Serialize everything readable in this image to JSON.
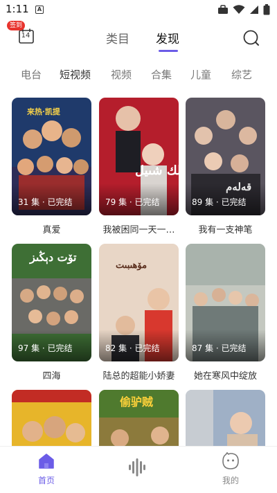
{
  "status_bar": {
    "time": "1:11",
    "a_badge": "A"
  },
  "header": {
    "checkin_badge": "签到",
    "calendar_day": "14",
    "tabs": [
      {
        "label": "类目",
        "active": false
      },
      {
        "label": "发现",
        "active": true
      }
    ]
  },
  "categories": [
    {
      "label": "电台",
      "active": false
    },
    {
      "label": "短视频",
      "active": true
    },
    {
      "label": "视频",
      "active": false
    },
    {
      "label": "合集",
      "active": false
    },
    {
      "label": "儿童",
      "active": false
    },
    {
      "label": "综艺",
      "active": false
    }
  ],
  "dramas": [
    {
      "title": "真爱",
      "episodes": "31 集 · 已完结",
      "color": "#1f3a6b",
      "poster_text": "来热·凯提"
    },
    {
      "title": "我被困同一天一…",
      "episodes": "79 集 · 已完结",
      "color": "#b51e2c",
      "poster_text": "ملك شىيل"
    },
    {
      "title": "我有一支神笔",
      "episodes": "89 集 · 已完结",
      "color": "#5a5560",
      "poster_text": "قەلەم"
    },
    {
      "title": "四海",
      "episodes": "97 集 · 已完结",
      "color": "#3e6f35",
      "poster_text": "تۆت دېڭىز"
    },
    {
      "title": "陆总的超能小娇妻",
      "episodes": "82 集 · 已完结",
      "color": "#e8d6c6",
      "poster_text": "مۆھىبىت"
    },
    {
      "title": "她在寒风中绽放",
      "episodes": "87 集 · 已完结",
      "color": "#c4c8c0",
      "poster_text": ""
    },
    {
      "title": "",
      "episodes": "",
      "color": "#e7b52a",
      "poster_text": ""
    },
    {
      "title": "",
      "episodes": "",
      "color": "#8c7a3c",
      "poster_text": "偷驴贼"
    },
    {
      "title": "",
      "episodes": "",
      "color": "#9fb0c6",
      "poster_text": ""
    }
  ],
  "bottom_nav": [
    {
      "label": "首页",
      "icon": "home-icon",
      "active": true
    },
    {
      "label": "",
      "icon": "waveform-icon",
      "active": false
    },
    {
      "label": "我的",
      "icon": "profile-icon",
      "active": false
    }
  ],
  "colors": {
    "accent": "#6b5ce7",
    "badge": "#e8332d"
  }
}
